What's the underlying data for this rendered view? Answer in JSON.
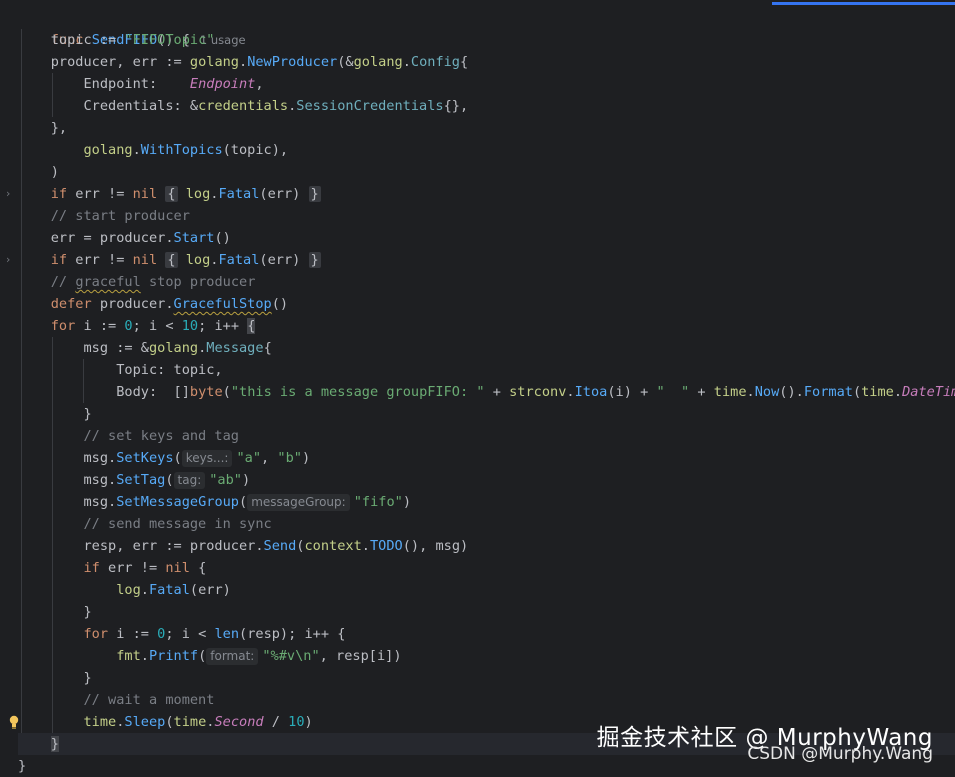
{
  "editor": {
    "usage_hint": "1 usage"
  },
  "code": {
    "l1_func": "func",
    "l1_name": "SendFIFO",
    "l1_rest": "() {",
    "l2_a": "topic := ",
    "l2_str": "\"FIFOTopic\"",
    "l3_a": "producer, err := ",
    "l3_pkg": "golang",
    "l3_fn": "NewProducer",
    "l3_b": "(&",
    "l3_pkg2": "golang",
    "l3_type": "Config",
    "l3_c": "{",
    "l4_field": "Endpoint:    ",
    "l4_const": "Endpoint",
    "l4_end": ",",
    "l5_field": "Credentials: &",
    "l5_pkg": "credentials",
    "l5_type": "SessionCredentials",
    "l5_end": "{},",
    "l6": "},",
    "l7_pkg": "golang",
    "l7_fn": "WithTopics",
    "l7_end": "(topic),",
    "l8": ")",
    "l9_if": "if",
    "l9_a": " err != ",
    "l9_nil": "nil",
    "l9_box_open": "{",
    "l9_log": "log",
    "l9_fatal": "Fatal",
    "l9_args": "(err)",
    "l9_box_close": "}",
    "l10_cm": "// start producer",
    "l11_a": "err = producer.",
    "l11_fn": "Start",
    "l11_end": "()",
    "l12_if": "if",
    "l12_a": " err != ",
    "l12_nil": "nil",
    "l12_box_open": "{",
    "l12_log": "log",
    "l12_fatal": "Fatal",
    "l12_args": "(err)",
    "l12_box_close": "}",
    "l13_cm1": "// ",
    "l13_cm_sq": "graceful",
    "l13_cm2": " stop producer",
    "l14_defer": "defer",
    "l14_a": " producer.",
    "l14_fn": "GracefulStop",
    "l14_end": "()",
    "l15_for": "for",
    "l15_a": " i := ",
    "l15_n0": "0",
    "l15_b": "; i < ",
    "l15_n10": "10",
    "l15_c": "; i++ ",
    "l15_brace": "{",
    "l16_a": "msg := &",
    "l16_pkg": "golang",
    "l16_type": "Message",
    "l16_end": "{",
    "l17": "Topic: topic,",
    "l18_a": "Body:  []",
    "l18_byte": "byte",
    "l18_b": "(",
    "l18_str": "\"this is a message groupFIFO: \"",
    "l18_c": " + ",
    "l18_pkg": "strconv",
    "l18_itoa": "Itoa",
    "l18_d": "(i) + ",
    "l18_str2": "\"  \"",
    "l18_e": " + ",
    "l18_time": "time",
    "l18_now": "Now",
    "l18_f": "().",
    "l18_format": "Format",
    "l18_g": "(",
    "l18_time2": "time",
    "l18_const": "DateTime",
    "l18_h": ")),",
    "l19": "}",
    "l20_cm": "// set keys and tag",
    "l21_a": "msg.",
    "l21_fn": "SetKeys",
    "l21_b": "(",
    "l21_hint": "keys...:",
    "l21_s1": "\"a\"",
    "l21_c": ", ",
    "l21_s2": "\"b\"",
    "l21_d": ")",
    "l22_a": "msg.",
    "l22_fn": "SetTag",
    "l22_b": "(",
    "l22_hint": "tag:",
    "l22_s": "\"ab\"",
    "l22_d": ")",
    "l23_a": "msg.",
    "l23_fn": "SetMessageGroup",
    "l23_b": "(",
    "l23_hint": "messageGroup:",
    "l23_s": "\"fifo\"",
    "l23_d": ")",
    "l24_cm": "// send message in sync",
    "l25_a": "resp, err := producer.",
    "l25_fn": "Send",
    "l25_b": "(",
    "l25_pkg": "context",
    "l25_todo": "TODO",
    "l25_c": "(), msg)",
    "l26_if": "if",
    "l26_a": " err != ",
    "l26_nil": "nil",
    "l26_b": " {",
    "l27_log": "log",
    "l27_fatal": "Fatal",
    "l27_args": "(err)",
    "l28": "}",
    "l29_for": "for",
    "l29_a": " i := ",
    "l29_n0": "0",
    "l29_b": "; i < ",
    "l29_len": "len",
    "l29_c": "(resp); i++ {",
    "l30_pkg": "fmt",
    "l30_fn": "Printf",
    "l30_b": "(",
    "l30_hint": "format:",
    "l30_s": "\"%#v\\n\"",
    "l30_c": ", resp[i])",
    "l31": "}",
    "l32_cm": "// wait a moment",
    "l33_time": "time",
    "l33_fn": "Sleep",
    "l33_b": "(",
    "l33_time2": "time",
    "l33_const": "Second",
    "l33_c": " / ",
    "l33_n": "10",
    "l33_d": ")",
    "l34": "}",
    "l35": "}"
  },
  "watermark": {
    "line1": "掘金技术社区 @ MurphyWang",
    "line2": "CSDN @Murphy.Wang"
  },
  "colors": {
    "background": "#1e1f22",
    "keyword": "#cf8e6d",
    "function": "#56a8f5",
    "string": "#6aab73",
    "number": "#2aacb8",
    "comment": "#7a7e85",
    "constant": "#c77dbb",
    "accent": "#3574f0"
  }
}
